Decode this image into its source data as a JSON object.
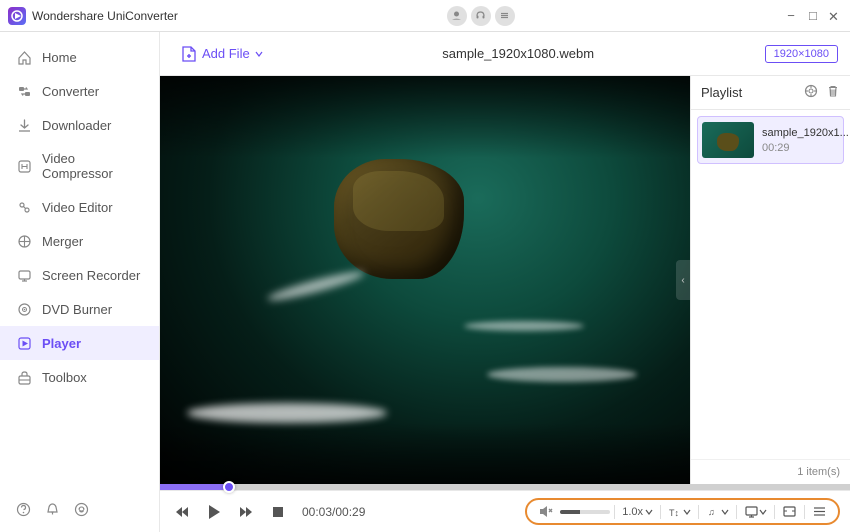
{
  "titleBar": {
    "appName": "Wondershare UniConverter",
    "controls": {
      "minimize": "−",
      "maximize": "□",
      "close": "✕"
    }
  },
  "sidebar": {
    "items": [
      {
        "id": "home",
        "label": "Home",
        "icon": "⌂",
        "active": false
      },
      {
        "id": "converter",
        "label": "Converter",
        "icon": "⟳",
        "active": false
      },
      {
        "id": "downloader",
        "label": "Downloader",
        "icon": "↓",
        "active": false
      },
      {
        "id": "video-compressor",
        "label": "Video Compressor",
        "icon": "⊞",
        "active": false
      },
      {
        "id": "video-editor",
        "label": "Video Editor",
        "icon": "✂",
        "active": false
      },
      {
        "id": "merger",
        "label": "Merger",
        "icon": "⊕",
        "active": false
      },
      {
        "id": "screen-recorder",
        "label": "Screen Recorder",
        "icon": "⊡",
        "active": false
      },
      {
        "id": "dvd-burner",
        "label": "DVD Burner",
        "icon": "◉",
        "active": false
      },
      {
        "id": "player",
        "label": "Player",
        "icon": "▶",
        "active": true
      },
      {
        "id": "toolbox",
        "label": "Toolbox",
        "icon": "⚙",
        "active": false
      }
    ],
    "bottomIcons": {
      "help": "?",
      "bell": "🔔",
      "emoji": "☺"
    }
  },
  "toolbar": {
    "addFileLabel": "Add File",
    "fileTitle": "sample_1920x1080.webm",
    "resolutionBadge": "1920×1080"
  },
  "playlist": {
    "title": "Playlist",
    "items": [
      {
        "name": "sample_1920x1...",
        "duration": "00:29"
      }
    ],
    "count": "1 item(s)"
  },
  "controls": {
    "rewind": "⏮",
    "play": "▶",
    "forward": "⏭",
    "stop": "■",
    "time": "00:03/00:29",
    "muteIcon": "🔇",
    "speed": "1.0x",
    "speedArrow": "▾",
    "subtitleIcon": "T↕",
    "audioIcon": "♫",
    "screenIcon": "⊡",
    "aspectIcon": "⊞",
    "playlistIcon": "☰"
  },
  "progressPercent": 10,
  "colors": {
    "accent": "#6b4ef5",
    "orange": "#e88a30",
    "active_bg": "#f0eeff"
  }
}
